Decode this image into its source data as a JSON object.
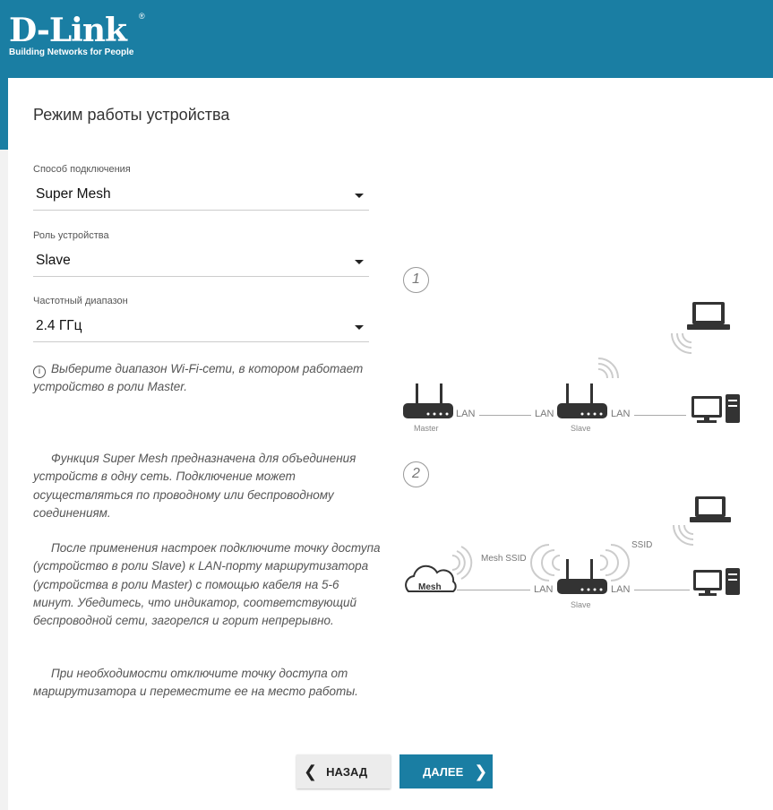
{
  "brand": {
    "name": "D-Link",
    "tagline": "Building Networks for People",
    "reg": "®"
  },
  "page": {
    "title": "Режим работы устройства"
  },
  "fields": [
    {
      "label": "Способ подключения",
      "value": "Super Mesh"
    },
    {
      "label": "Роль устройства",
      "value": "Slave"
    },
    {
      "label": "Частотный диапазон",
      "value": "2.4 ГГц"
    }
  ],
  "hint": "Выберите диапазон Wi-Fi-сети, в котором работает устройство в роли Master.",
  "description": [
    "Функция Super Mesh предназначена для объединения устройств в одну сеть. Подключение может осуществляться по проводному или беспроводному соединениям.",
    "После применения настроек подключите точку доступа (устройство в роли Slave) к LAN-порту маршрутизатора (устройства в роли Master) с помощью кабеля на 5-6 минут. Убедитесь, что индикатор, соответствующий беспроводной сети, загорелся и горит непрерывно.",
    "При необходимости отключите точку доступа от маршрутизатора и переместите ее на место работы."
  ],
  "diagram": {
    "step1": "1",
    "step2": "2",
    "lan": "LAN",
    "master": "Master",
    "slave": "Slave",
    "mesh": "Mesh",
    "mesh_ssid": "Mesh SSID",
    "ssid": "SSID"
  },
  "buttons": {
    "back": "НАЗАД",
    "next": "ДАЛЕЕ"
  },
  "colors": {
    "brand": "#1a7ea3",
    "back_button": "#ececec"
  },
  "icons": {
    "info": "info-icon",
    "router": "router-icon",
    "laptop": "laptop-icon",
    "desktop": "desktop-icon",
    "cloud": "cloud-icon",
    "wifi": "wifi-icon",
    "back": "chevron-left-icon",
    "next": "chevron-right-icon"
  }
}
